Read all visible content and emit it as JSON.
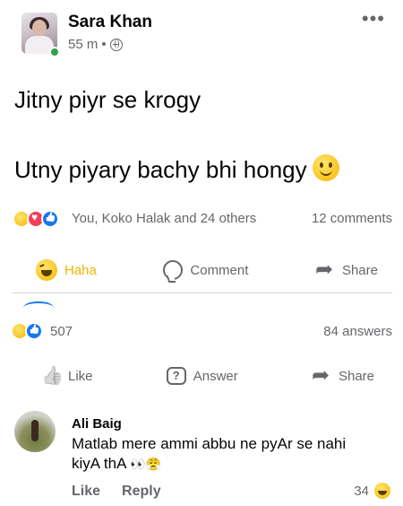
{
  "post": {
    "author": "Sara Khan",
    "time": "55 m",
    "separator": "•",
    "privacy_icon": "globe-icon",
    "more_icon": "•••",
    "lines": [
      "Jitny piyr se krogy",
      "Utny piyary bachy bhi hongy"
    ],
    "emoji": "smile-emoji"
  },
  "reactions": {
    "icons": [
      "haha",
      "love",
      "like"
    ],
    "names": "You, Koko Halak and 24 others",
    "comments": "12 comments"
  },
  "actions": {
    "haha": "Haha",
    "comment": "Comment",
    "share": "Share"
  },
  "question": {
    "reaction_count": "507",
    "answers": "84 answers",
    "like": "Like",
    "answer": "Answer",
    "share": "Share"
  },
  "comment": {
    "author": "Ali Baig",
    "text": "Matlab mere ammi abbu ne pyAr se nahi kiyA thA",
    "emojis": "👀😤",
    "like": "Like",
    "reply": "Reply",
    "reaction_count": "34"
  },
  "colors": {
    "primary_text": "#050505",
    "secondary_text": "#65676b",
    "haha_active": "#f0b400",
    "online": "#31a24c",
    "like_blue": "#1877f2",
    "love_red": "#f33e58"
  }
}
